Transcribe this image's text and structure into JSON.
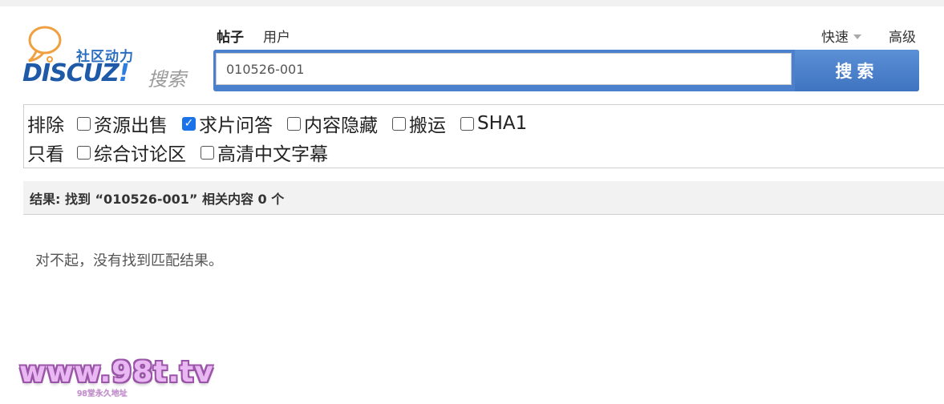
{
  "logo": {
    "cn_text": "社区动力",
    "brand_text": "DISCUZ",
    "brand_excl": "!",
    "sub_text": "搜索"
  },
  "search": {
    "tabs": [
      {
        "label": "帖子",
        "active": true
      },
      {
        "label": "用户",
        "active": false
      }
    ],
    "quick_label": "快速",
    "advanced_label": "高级",
    "query_value": "010526-001",
    "button_label": "搜索"
  },
  "filters": {
    "exclude_label": "排除",
    "exclude_options": [
      {
        "label": "资源出售",
        "checked": false
      },
      {
        "label": "求片问答",
        "checked": true
      },
      {
        "label": "内容隐藏",
        "checked": false
      },
      {
        "label": "搬运",
        "checked": false
      },
      {
        "label": "SHA1",
        "checked": false
      }
    ],
    "only_label": "只看",
    "only_options": [
      {
        "label": "综合讨论区",
        "checked": false
      },
      {
        "label": "高清中文字幕",
        "checked": false
      }
    ]
  },
  "result": {
    "text": "结果: 找到 “010526-001” 相关内容 0 个",
    "empty_message": "对不起，没有找到匹配结果。"
  },
  "watermark": {
    "main": "www.98t.tv",
    "sub": "98堂永久地址"
  },
  "colors": {
    "accent": "#4a80cc",
    "checkbox_checked": "#1a73e8"
  }
}
